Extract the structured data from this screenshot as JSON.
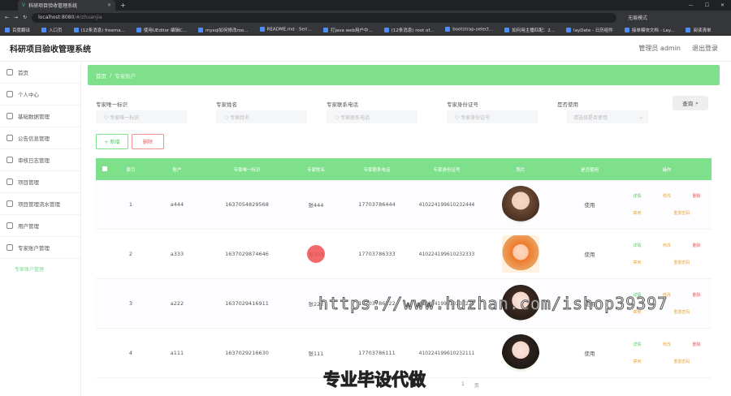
{
  "browser": {
    "tab_title": "科研项目验收管理系统",
    "url_host": "localhost:8080",
    "url_path": "/#/zhuanjia",
    "incognito_label": "无痕模式",
    "bookmarks": [
      "百度翻译",
      "入口页",
      "(12条消息) freema...",
      "使用UEditor 编辑C...",
      "mysql如何修改roo...",
      "README.md · Seri...",
      "打java web用户中...",
      "(12条消息) root of...",
      "bootstrap-select...",
      "如何用主播匹配：2...",
      "layDate - 日历组件",
      "接单模块文档 - Lay...",
      "阅读清单"
    ]
  },
  "app": {
    "title": "科研项目验收管理系统",
    "user_label": "管理员 admin",
    "logout_label": "退出登录"
  },
  "sidebar": {
    "items": [
      {
        "label": "首页"
      },
      {
        "label": "个人中心"
      },
      {
        "label": "基础数据管理"
      },
      {
        "label": "公告信息管理"
      },
      {
        "label": "审核日志管理"
      },
      {
        "label": "项目管理"
      },
      {
        "label": "项目管理流水管理"
      },
      {
        "label": "用户管理"
      },
      {
        "label": "专家账户管理"
      }
    ],
    "active_sub": "专家账户管理"
  },
  "breadcrumb": {
    "home": "首页",
    "sep": "/",
    "current": "专家账户"
  },
  "filters": {
    "f1_label": "专家唯一标识",
    "f1_placeholder": "专家唯一标识",
    "f2_label": "专家姓名",
    "f2_placeholder": "专家姓名",
    "f3_label": "专家联系电话",
    "f3_placeholder": "专家联系电话",
    "f4_label": "专家身份证号",
    "f4_placeholder": "专家身份证号",
    "f5_label": "是否使用",
    "f5_placeholder": "请选择是否使用",
    "search_label": "查询"
  },
  "actions": {
    "add_label": "+ 新增",
    "delete_label": "删除"
  },
  "table": {
    "headers": [
      "索引",
      "账户",
      "专家唯一标识",
      "专家姓名",
      "专家联系电话",
      "专家身份证号",
      "照片",
      "是否使用",
      "操作"
    ],
    "rows": [
      {
        "idx": "1",
        "account": "a444",
        "uid": "1637054829568",
        "name": "张444",
        "phone": "17703786444",
        "idcard": "410224199610232444",
        "state": "使用"
      },
      {
        "idx": "2",
        "account": "a333",
        "uid": "1637029874646",
        "name": "张333",
        "phone": "17703786333",
        "idcard": "410224199610232333",
        "state": "使用"
      },
      {
        "idx": "3",
        "account": "a222",
        "uid": "1637029416911",
        "name": "张222",
        "phone": "17703786222",
        "idcard": "410224199610232222",
        "state": "使用"
      },
      {
        "idx": "4",
        "account": "a111",
        "uid": "1637029216630",
        "name": "张111",
        "phone": "17703786111",
        "idcard": "410224199610232111",
        "state": "使用"
      }
    ],
    "ops": {
      "view": "详情",
      "edit": "修改",
      "delete": "删除",
      "toggle": "禁用",
      "reset": "重置密码"
    }
  },
  "pager": {
    "page": "1",
    "unit": "页"
  },
  "overlay": {
    "watermark": "https://www.huzhan.com/ishop39397",
    "caption": "专业毕设代做"
  }
}
